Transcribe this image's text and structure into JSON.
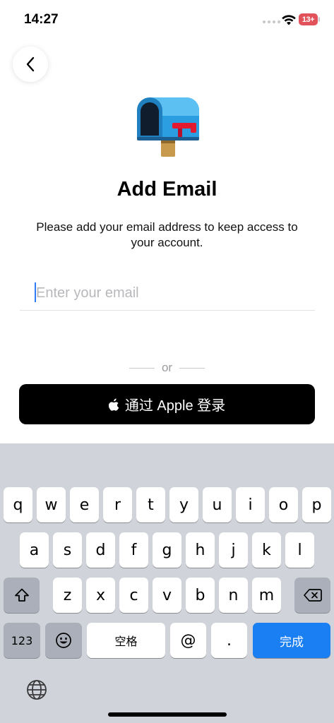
{
  "status": {
    "time": "14:27",
    "battery": "13+"
  },
  "page": {
    "title": "Add Email",
    "subtitle": "Please add your email address to keep access to your account."
  },
  "email": {
    "placeholder": "Enter your email",
    "value": ""
  },
  "divider": {
    "text": "or"
  },
  "apple_signin": {
    "label": "通过 Apple 登录"
  },
  "keyboard": {
    "row1": [
      "q",
      "w",
      "e",
      "r",
      "t",
      "y",
      "u",
      "i",
      "o",
      "p"
    ],
    "row2": [
      "a",
      "s",
      "d",
      "f",
      "g",
      "h",
      "j",
      "k",
      "l"
    ],
    "row3": [
      "z",
      "x",
      "c",
      "v",
      "b",
      "n",
      "m"
    ],
    "numbers_label": "123",
    "space_label": "空格",
    "at_label": "@",
    "dot_label": ".",
    "done_label": "完成"
  },
  "colors": {
    "accent": "#1a7ff3",
    "caret": "#2e7cf6",
    "battery": "#e2525a",
    "keyboard_bg": "#d1d3da"
  }
}
